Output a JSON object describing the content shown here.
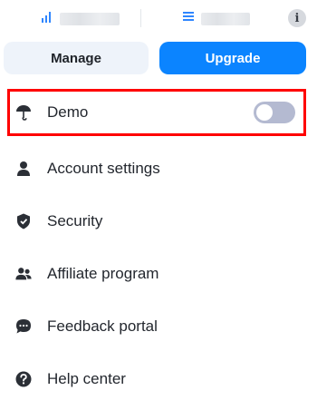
{
  "stats": {
    "left_icon": "signal-bars-icon",
    "right_icon": "list-lines-icon",
    "info_icon": "info-icon",
    "info_glyph": "i"
  },
  "actions": {
    "manage_label": "Manage",
    "upgrade_label": "Upgrade"
  },
  "menu": [
    {
      "id": "demo",
      "label": "Demo",
      "icon": "umbrella-icon",
      "toggle_on": false
    },
    {
      "id": "account-settings",
      "label": "Account settings",
      "icon": "person-icon"
    },
    {
      "id": "security",
      "label": "Security",
      "icon": "shield-icon"
    },
    {
      "id": "affiliate-program",
      "label": "Affiliate program",
      "icon": "people-icon"
    },
    {
      "id": "feedback-portal",
      "label": "Feedback portal",
      "icon": "chat-bubble-icon"
    },
    {
      "id": "help-center",
      "label": "Help center",
      "icon": "question-circle-icon"
    }
  ],
  "colors": {
    "accent": "#0b84ff",
    "highlight": "#ff0000",
    "toggle_off": "#b4bad1",
    "icon": "#2b2f36"
  }
}
